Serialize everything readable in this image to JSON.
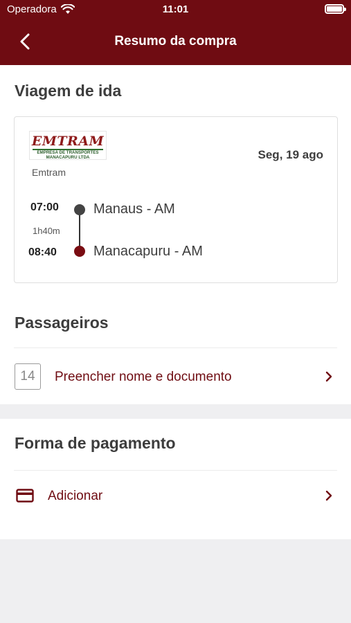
{
  "status_bar": {
    "carrier": "Operadora",
    "time": "11:01"
  },
  "header": {
    "title": "Resumo da compra"
  },
  "outbound": {
    "section_title": "Viagem de ida",
    "company": {
      "logo_text": "EMTRAM",
      "logo_subtext": "EMPRESA DE TRANSPORTES MANACAPURU LTDA",
      "name": "Emtram"
    },
    "date": "Seg, 19 ago",
    "departure": {
      "time": "07:00",
      "city": "Manaus - AM"
    },
    "duration": "1h40m",
    "arrival": {
      "time": "08:40",
      "city": "Manacapuru - AM"
    }
  },
  "passengers": {
    "section_title": "Passageiros",
    "count": "14",
    "action_label": "Preencher nome e documento"
  },
  "payment": {
    "section_title": "Forma de pagamento",
    "action_label": "Adicionar"
  },
  "colors": {
    "brand": "#6f0c12",
    "departure_dot": "#444444",
    "arrival_dot": "#7a0c12"
  }
}
